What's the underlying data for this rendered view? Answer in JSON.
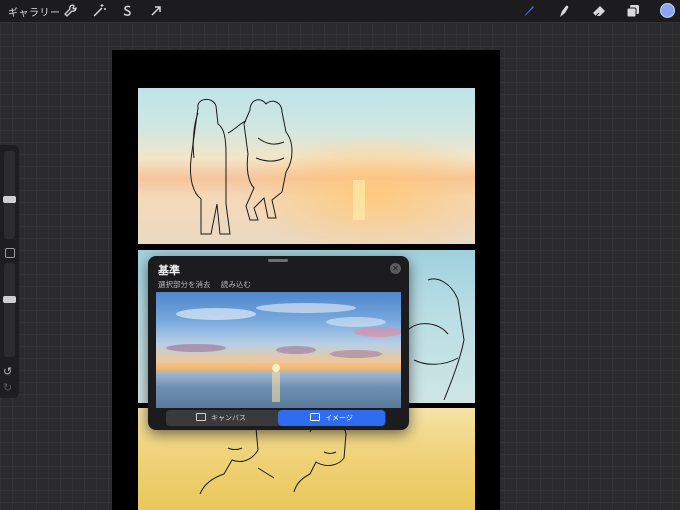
{
  "topbar": {
    "gallery_label": "ギャラリー",
    "left_icons": [
      "wrench-icon",
      "magic-wand-icon",
      "selection-s-icon",
      "transform-arrow-icon"
    ],
    "right_icons": [
      "brush-icon",
      "smudge-icon",
      "eraser-icon",
      "layers-icon"
    ],
    "active_tool": "brush",
    "accent_color": "#3c7cf0",
    "current_color": "#8aa6f2"
  },
  "sidebar": {
    "brush_size_level": 0.45,
    "opacity_level": 0.62,
    "undo_label": "↺",
    "redo_label": "↻"
  },
  "reference": {
    "title": "基準",
    "actions": [
      "選択部分を消去",
      "読み込む"
    ],
    "tabs": [
      {
        "label": "キャンバス",
        "active": false
      },
      {
        "label": "イメージ",
        "active": true
      }
    ],
    "tab_active_color": "#2f6df0"
  }
}
